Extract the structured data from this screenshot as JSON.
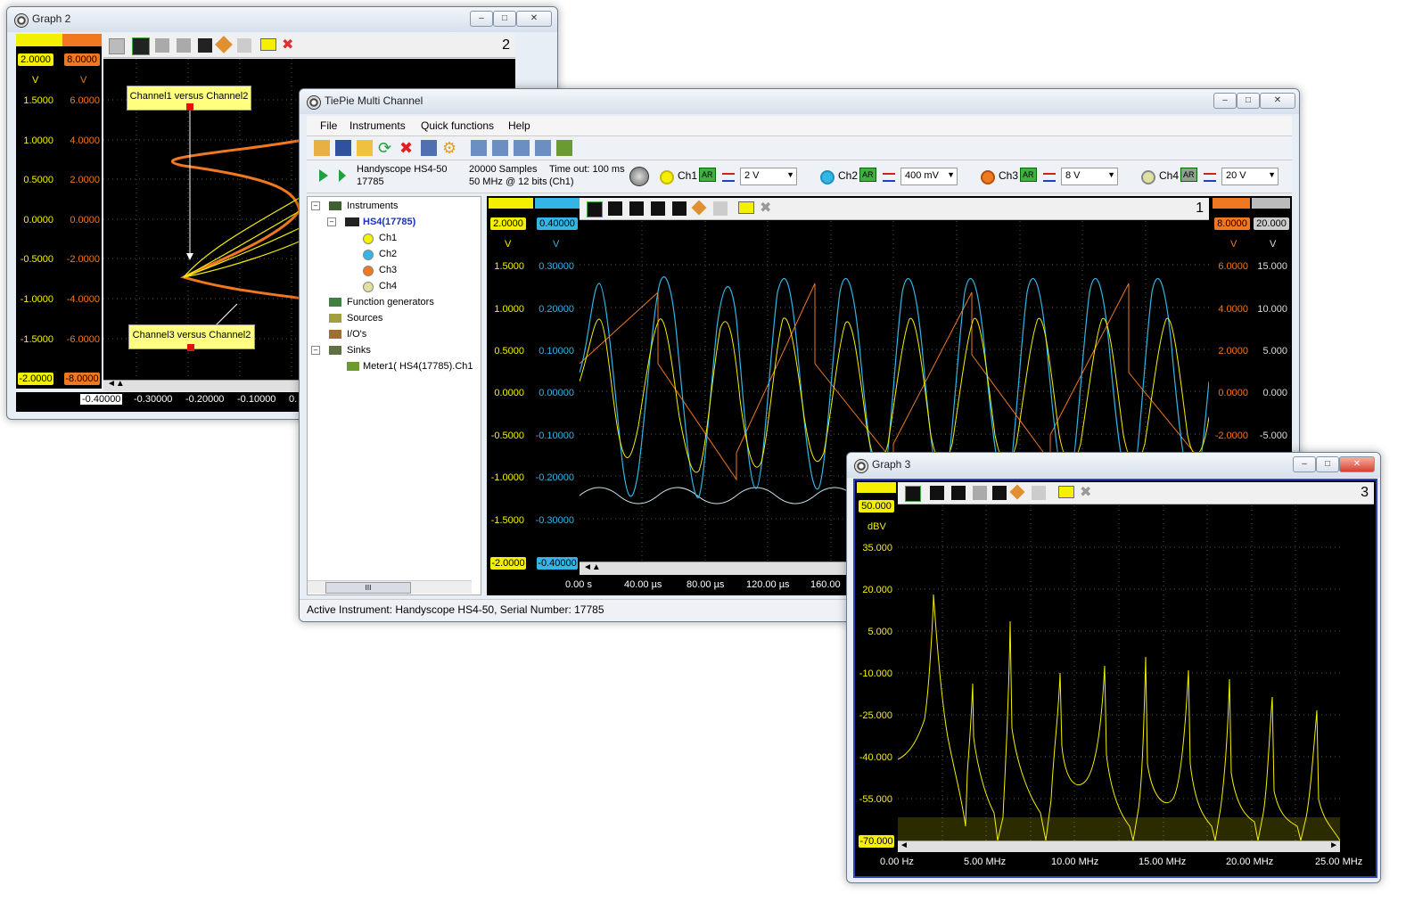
{
  "graph2": {
    "title": "Graph 2",
    "number": "2",
    "left_badges": {
      "ch1_top": "2.0000",
      "ch3_top": "8.0000",
      "ch1_bottom": "-2.0000",
      "ch3_bottom": "-8.0000"
    },
    "units": {
      "a": "V",
      "b": "V"
    },
    "y_ticks_ch1": [
      "1.5000",
      "1.0000",
      "0.5000",
      "0.0000",
      "-0.5000",
      "-1.0000",
      "-1.5000"
    ],
    "y_ticks_ch3": [
      "6.0000",
      "4.0000",
      "2.0000",
      "0.0000",
      "-2.0000",
      "-4.0000",
      "-6.0000"
    ],
    "x_ticks": [
      "-0.40000",
      "-0.30000",
      "-0.20000",
      "-0.10000",
      "0."
    ],
    "annotation1": "Channel1 versus Channel2",
    "annotation2": "Channel3 versus Channel2"
  },
  "main": {
    "title": "TiePie Multi Channel",
    "menu": [
      "File",
      "Instruments",
      "Quick functions",
      "Help"
    ],
    "instrument": {
      "name": "Handyscope HS4-50",
      "serial": "17785"
    },
    "samples": {
      "line1": "20000 Samples",
      "line2": "50 MHz @ 12 bits"
    },
    "timeout": {
      "line1": "Time out: 100 ms",
      "line2": "(Ch1)"
    },
    "channels": [
      {
        "label": "Ch1",
        "range": "2 V",
        "color": "#f5f000"
      },
      {
        "label": "Ch2",
        "range": "400 mV",
        "color": "#33b5e5"
      },
      {
        "label": "Ch3",
        "range": "8 V",
        "color": "#f07820"
      },
      {
        "label": "Ch4",
        "range": "20 V",
        "color": "#d0d0d0"
      }
    ],
    "ar_label": "AR",
    "tree": {
      "instruments": "Instruments",
      "device": "HS4(17785)",
      "ch": [
        "Ch1",
        "Ch2",
        "Ch3",
        "Ch4"
      ],
      "function_generators": "Function generators",
      "sources": "Sources",
      "ios": "I/O's",
      "sinks": "Sinks",
      "meter": "Meter1( HS4(17785).Ch1"
    },
    "scroll_thumb": "III",
    "status": "Active Instrument: Handyscope HS4-50, Serial Number: 17785",
    "graph1": {
      "number": "1",
      "badges_left": {
        "ch1_top": "2.0000",
        "ch2_top": "0.40000",
        "ch1_bottom": "-2.0000",
        "ch2_bottom": "-0.40000"
      },
      "badges_right": {
        "ch3_top": "8.0000",
        "ch4_top": "20.000"
      },
      "units": "V",
      "y_ch1": [
        "1.5000",
        "1.0000",
        "0.5000",
        "0.0000",
        "-0.5000",
        "-1.0000",
        "-1.5000"
      ],
      "y_ch2": [
        "0.30000",
        "0.20000",
        "0.10000",
        "0.00000",
        "-0.10000",
        "-0.20000",
        "-0.30000"
      ],
      "y_ch3": [
        "6.0000",
        "4.0000",
        "2.0000",
        "0.0000",
        "-2.0000"
      ],
      "y_ch4": [
        "15.000",
        "10.000",
        "5.000",
        "0.000",
        "-5.000"
      ],
      "x_ticks": [
        "0.00 s",
        "40.00 µs",
        "80.00 µs",
        "120.00 µs",
        "160.00"
      ]
    }
  },
  "graph3": {
    "title": "Graph 3",
    "number": "3",
    "top_badge": "50.000",
    "unit": "dBV",
    "y_ticks": [
      "35.000",
      "20.000",
      "5.000",
      "-10.000",
      "-25.000",
      "-40.000",
      "-55.000"
    ],
    "bottom_badge": "-70.000",
    "x_ticks": [
      "0.00 Hz",
      "5.00 MHz",
      "10.00 MHz",
      "15.00 MHz",
      "20.00 MHz",
      "25.00 MHz"
    ]
  }
}
